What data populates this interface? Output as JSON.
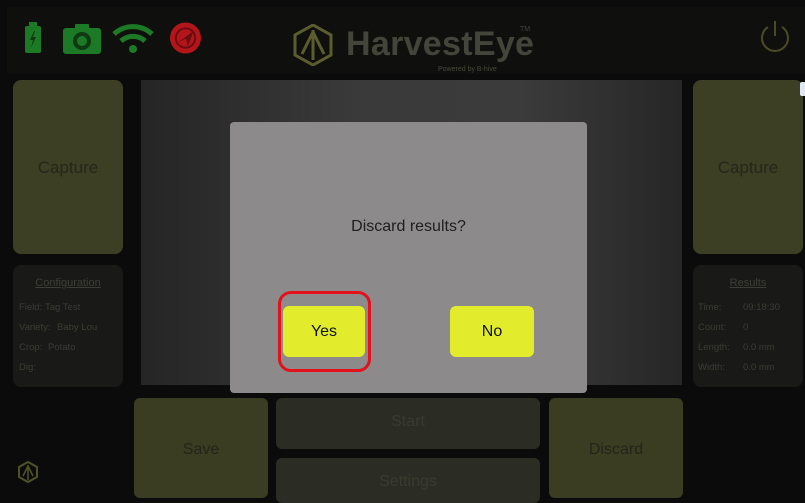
{
  "brand": {
    "name": "HarvestEye",
    "trademark": "TM",
    "tagline": "Powered by B-hive"
  },
  "status_icons": [
    "battery-icon",
    "camera-icon",
    "wifi-icon",
    "gps-icon"
  ],
  "left_panel": {
    "capture_label": "Capture",
    "config": {
      "title": "Configuration",
      "rows": [
        {
          "key": "Field:",
          "value": "Tag Test"
        },
        {
          "key": "Variety:",
          "value": "Baby Lou"
        },
        {
          "key": "Crop:",
          "value": "Potato"
        },
        {
          "key": "Dig:",
          "value": ""
        }
      ]
    }
  },
  "right_panel": {
    "capture_label": "Capture",
    "results": {
      "title": "Results",
      "rows": [
        {
          "key": "Time:",
          "value": "09:18:30"
        },
        {
          "key": "Count:",
          "value": "0"
        },
        {
          "key": "Length:",
          "value": "0.0 mm"
        },
        {
          "key": "Width:",
          "value": "0.0 mm"
        }
      ]
    }
  },
  "bottom": {
    "save_label": "Save",
    "start_label": "Start",
    "settings_label": "Settings",
    "discard_label": "Discard"
  },
  "dialog": {
    "message": "Discard results?",
    "yes_label": "Yes",
    "no_label": "No"
  },
  "colors": {
    "accent": "#e2ec2c",
    "highlight": "#e3111b",
    "battery": "#1f8a2b",
    "camera": "#1f8a2b",
    "wifi": "#1f8a2b",
    "gps": "#c0161a"
  }
}
